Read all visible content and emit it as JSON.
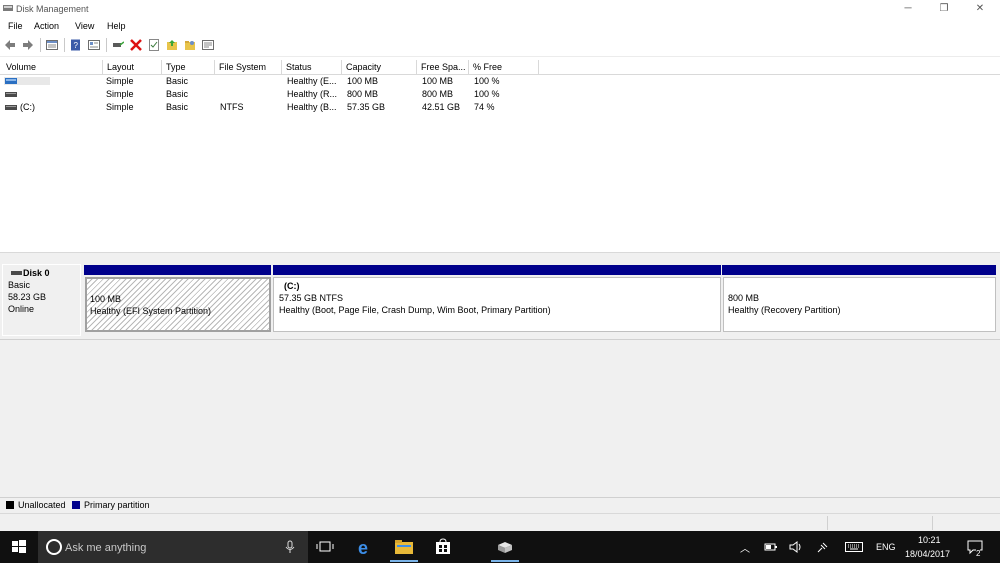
{
  "window": {
    "title": "Disk Management",
    "icon": "disk-management-icon"
  },
  "menu": [
    "File",
    "Action",
    "View",
    "Help"
  ],
  "toolbar": {
    "icons": [
      "back-arrow-icon",
      "forward-arrow-icon",
      "list-view-icon",
      "help-icon",
      "properties-icon",
      "connect-icon",
      "delete-icon",
      "check-icon",
      "folder-up-icon",
      "folder-icon",
      "console-icon"
    ]
  },
  "volumes": {
    "columns": [
      "Volume",
      "Layout",
      "Type",
      "File System",
      "Status",
      "Capacity",
      "Free Spa...",
      "% Free"
    ],
    "rows": [
      {
        "volume": "",
        "layout": "Simple",
        "type": "Basic",
        "fs": "",
        "status": "Healthy (E...",
        "capacity": "100 MB",
        "free": "100 MB",
        "pct": "100 %"
      },
      {
        "volume": "",
        "layout": "Simple",
        "type": "Basic",
        "fs": "",
        "status": "Healthy (R...",
        "capacity": "800 MB",
        "free": "800 MB",
        "pct": "100 %"
      },
      {
        "volume": "(C:)",
        "layout": "Simple",
        "type": "Basic",
        "fs": "NTFS",
        "status": "Healthy (B...",
        "capacity": "57.35 GB",
        "free": "42.51 GB",
        "pct": "74 %"
      }
    ]
  },
  "disk": {
    "name": "Disk 0",
    "type": "Basic",
    "size": "58.23 GB",
    "state": "Online",
    "partitions": [
      {
        "title": "",
        "size": "100 MB",
        "status": "Healthy (EFI System Partition)"
      },
      {
        "title": "(C:)",
        "size": "57.35 GB NTFS",
        "status": "Healthy (Boot, Page File, Crash Dump, Wim Boot, Primary Partition)"
      },
      {
        "title": "",
        "size": "800 MB",
        "status": "Healthy (Recovery Partition)"
      }
    ]
  },
  "legend": {
    "unallocated": "Unallocated",
    "primary": "Primary partition",
    "unallocated_color": "#000000",
    "primary_color": "#00008b"
  },
  "taskbar": {
    "search_placeholder": "Ask me anything",
    "language": "ENG",
    "time": "10:21",
    "date": "18/04/2017",
    "notification_count": "2"
  }
}
